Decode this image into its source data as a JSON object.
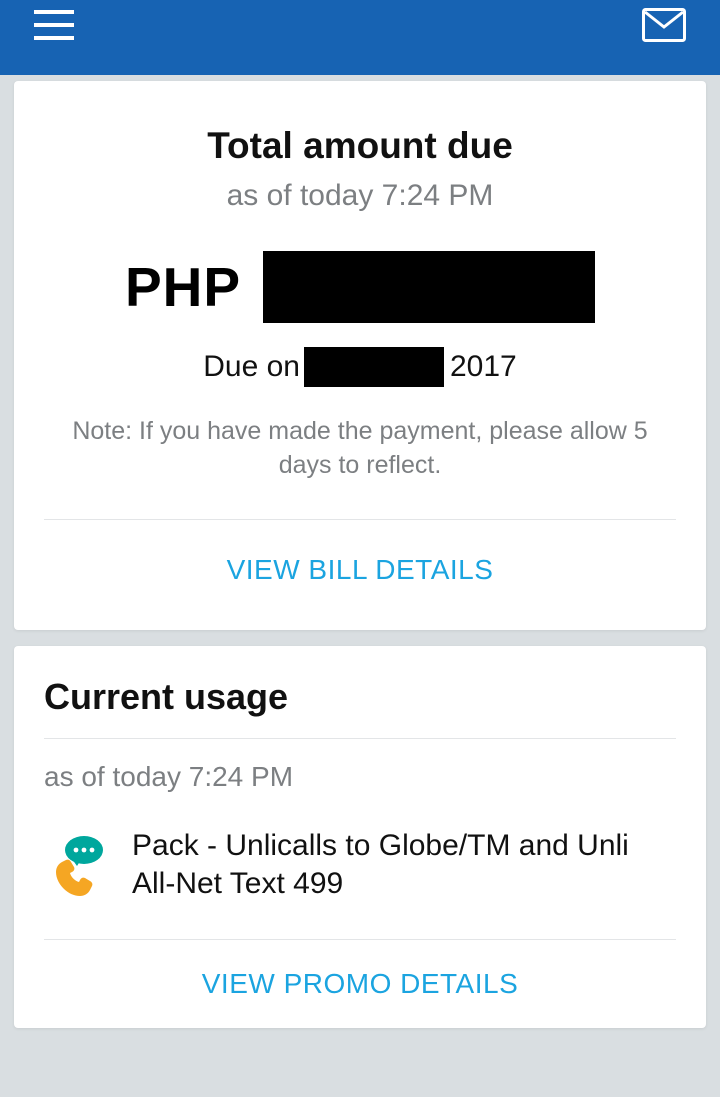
{
  "bill": {
    "title": "Total amount due",
    "subtitle": "as of today 7:24 PM",
    "currency": "PHP",
    "due_prefix": "Due on",
    "due_year": "2017",
    "note": "Note: If you have made the payment, please allow 5 days to reflect.",
    "view_bill_label": "VIEW BILL DETAILS"
  },
  "usage": {
    "title": "Current usage",
    "subtitle": "as of today 7:24 PM",
    "pack_text": "Pack - Unlicalls to Globe/TM and Unli All-Net Text 499",
    "view_promo_label": "VIEW PROMO DETAILS"
  }
}
